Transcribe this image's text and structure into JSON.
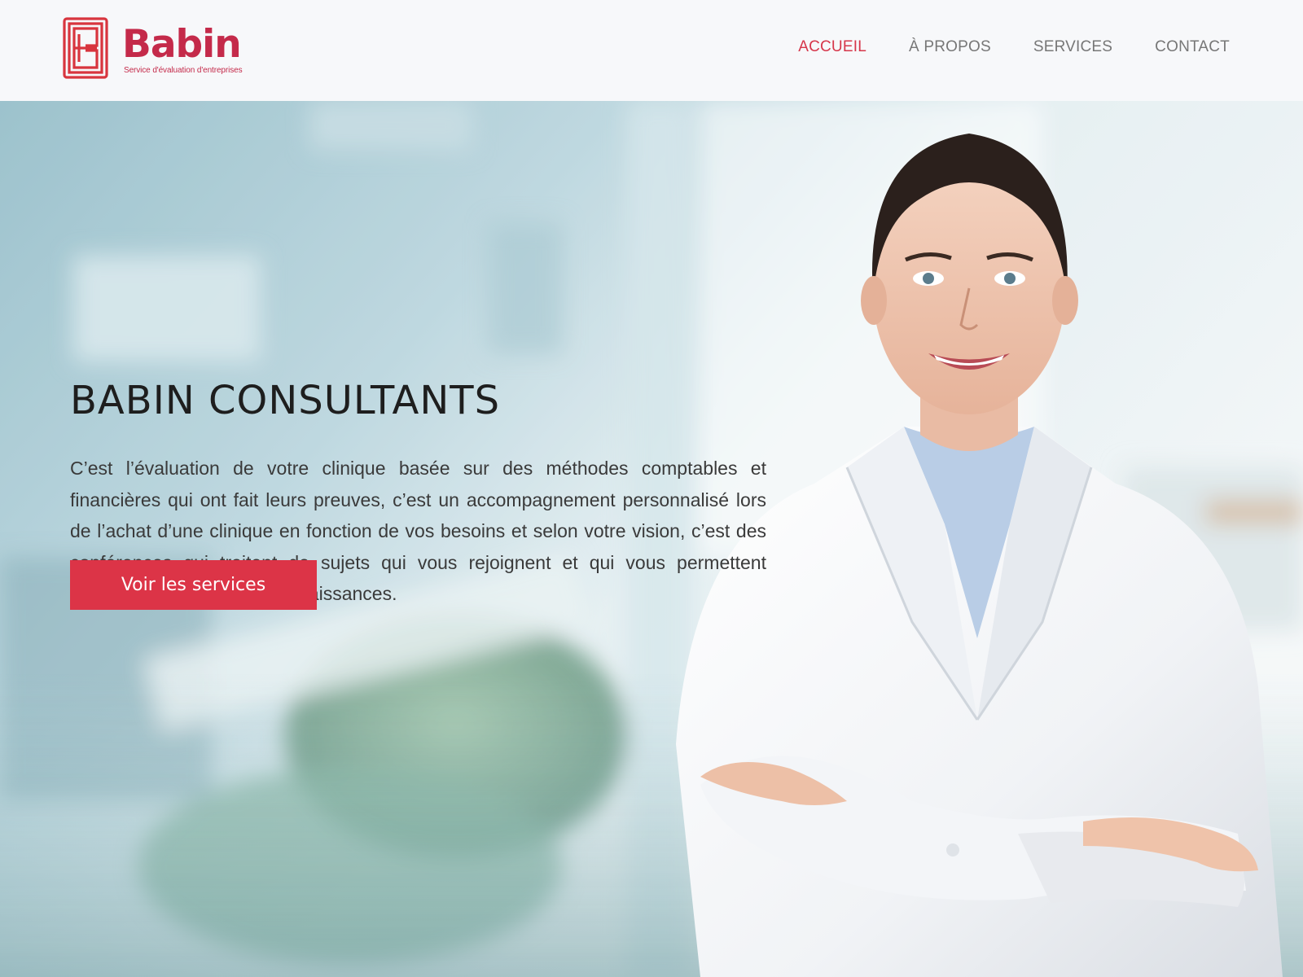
{
  "brand": {
    "name": "Babin",
    "tagline": "Service d'évaluation d'entreprises",
    "color": "#c42a4a"
  },
  "nav": {
    "items": [
      {
        "label": "ACCUEIL",
        "active": true
      },
      {
        "label": "À PROPOS",
        "active": false
      },
      {
        "label": "SERVICES",
        "active": false
      },
      {
        "label": "CONTACT",
        "active": false
      }
    ],
    "active_color": "#d6374b"
  },
  "hero": {
    "title": "BABIN CONSULTANTS",
    "description": "C’est l’évaluation de votre clinique basée sur des méthodes comptables et financières qui ont fait leurs preuves, c’est un accompagnement personnalisé lors de l’achat d’une clinique en fonction de vos besoins et selon votre vision, c’est des conférences qui traitent de sujets qui vous rejoignent et qui vous permettent d’acquérir de nouvelles connaissances.",
    "cta_label": "Voir les services",
    "cta_color": "#dc3447"
  }
}
